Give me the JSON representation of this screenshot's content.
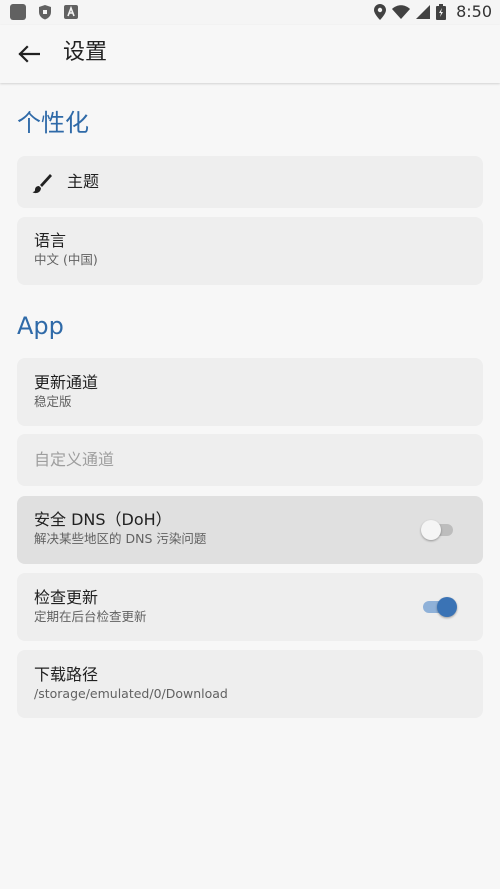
{
  "status_bar": {
    "time": "8:50",
    "icons": [
      "gallery-icon",
      "shield-icon",
      "a-icon",
      "location-icon",
      "wifi-icon",
      "signal-icon",
      "battery-icon"
    ]
  },
  "app_bar": {
    "title": "设置",
    "back_icon": "arrow-left-icon"
  },
  "sections": {
    "personalization": {
      "title": "个性化",
      "theme": {
        "title": "主题",
        "icon": "brush-icon"
      },
      "language": {
        "title": "语言",
        "value": "中文 (中国)"
      }
    },
    "app": {
      "title": "App",
      "update_channel": {
        "title": "更新通道",
        "value": "稳定版"
      },
      "custom_channel": {
        "title": "自定义通道"
      },
      "secure_dns": {
        "title": "安全 DNS（DoH）",
        "subtitle": "解决某些地区的 DNS 污染问题",
        "enabled": false
      },
      "check_updates": {
        "title": "检查更新",
        "subtitle": "定期在后台检查更新",
        "enabled": true
      },
      "download_path": {
        "title": "下载路径",
        "value": "/storage/emulated/0/Download"
      }
    }
  },
  "colors": {
    "accent": "#2f6aa8",
    "switch_on": "#3a73b5",
    "card_bg": "#eeeeee"
  }
}
